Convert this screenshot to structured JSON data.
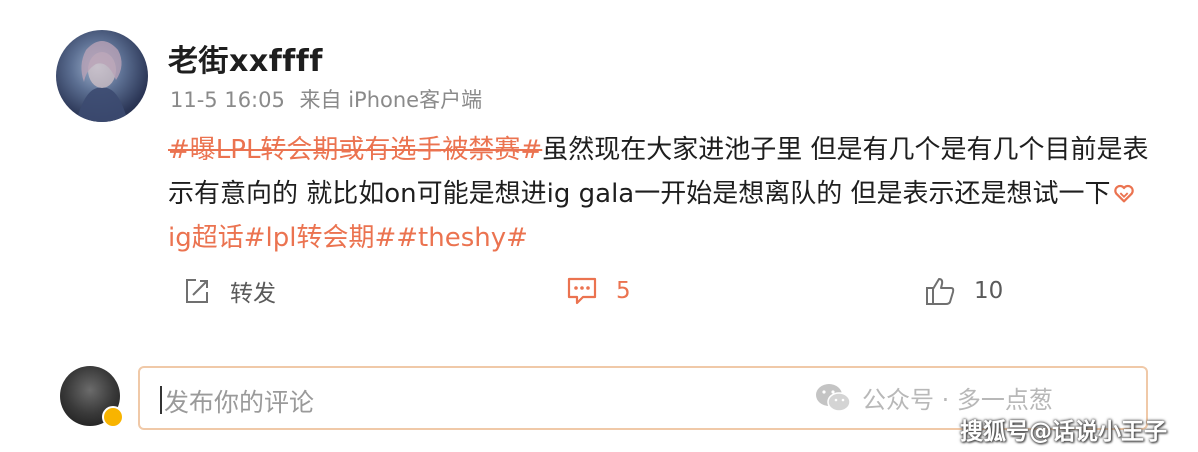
{
  "post": {
    "username": "老街xxffff",
    "time": "11-5 16:05",
    "source": "来自 iPhone客户端",
    "content": {
      "tag_headline": "#曝LPL转会期或有选手被禁赛#",
      "text": "虽然现在大家进池子里 但是有几个是有几个目前是表示有意向的 就比如on可能是想进ig gala一开始是想离队的 但是表示还是想试一下",
      "tag_super": "ig超话",
      "tag_lpl": "#lpl转会期#",
      "tag_theshy": "#theshy#"
    }
  },
  "actions": {
    "repost_label": "转发",
    "comment_count": "5",
    "like_count": "10"
  },
  "composer": {
    "placeholder": "发布你的评论"
  },
  "watermarks": {
    "wechat": "公众号 · 多一点葱",
    "sohu": "搜狐号@话说小王子"
  },
  "colors": {
    "accent": "#eb7350",
    "meta_gray": "#8a8a8a"
  },
  "icons": {
    "repost": "repost-icon",
    "comment": "comment-icon",
    "like": "thumbs-up-icon",
    "super_topic": "heart-icon",
    "wechat": "wechat-icon"
  }
}
